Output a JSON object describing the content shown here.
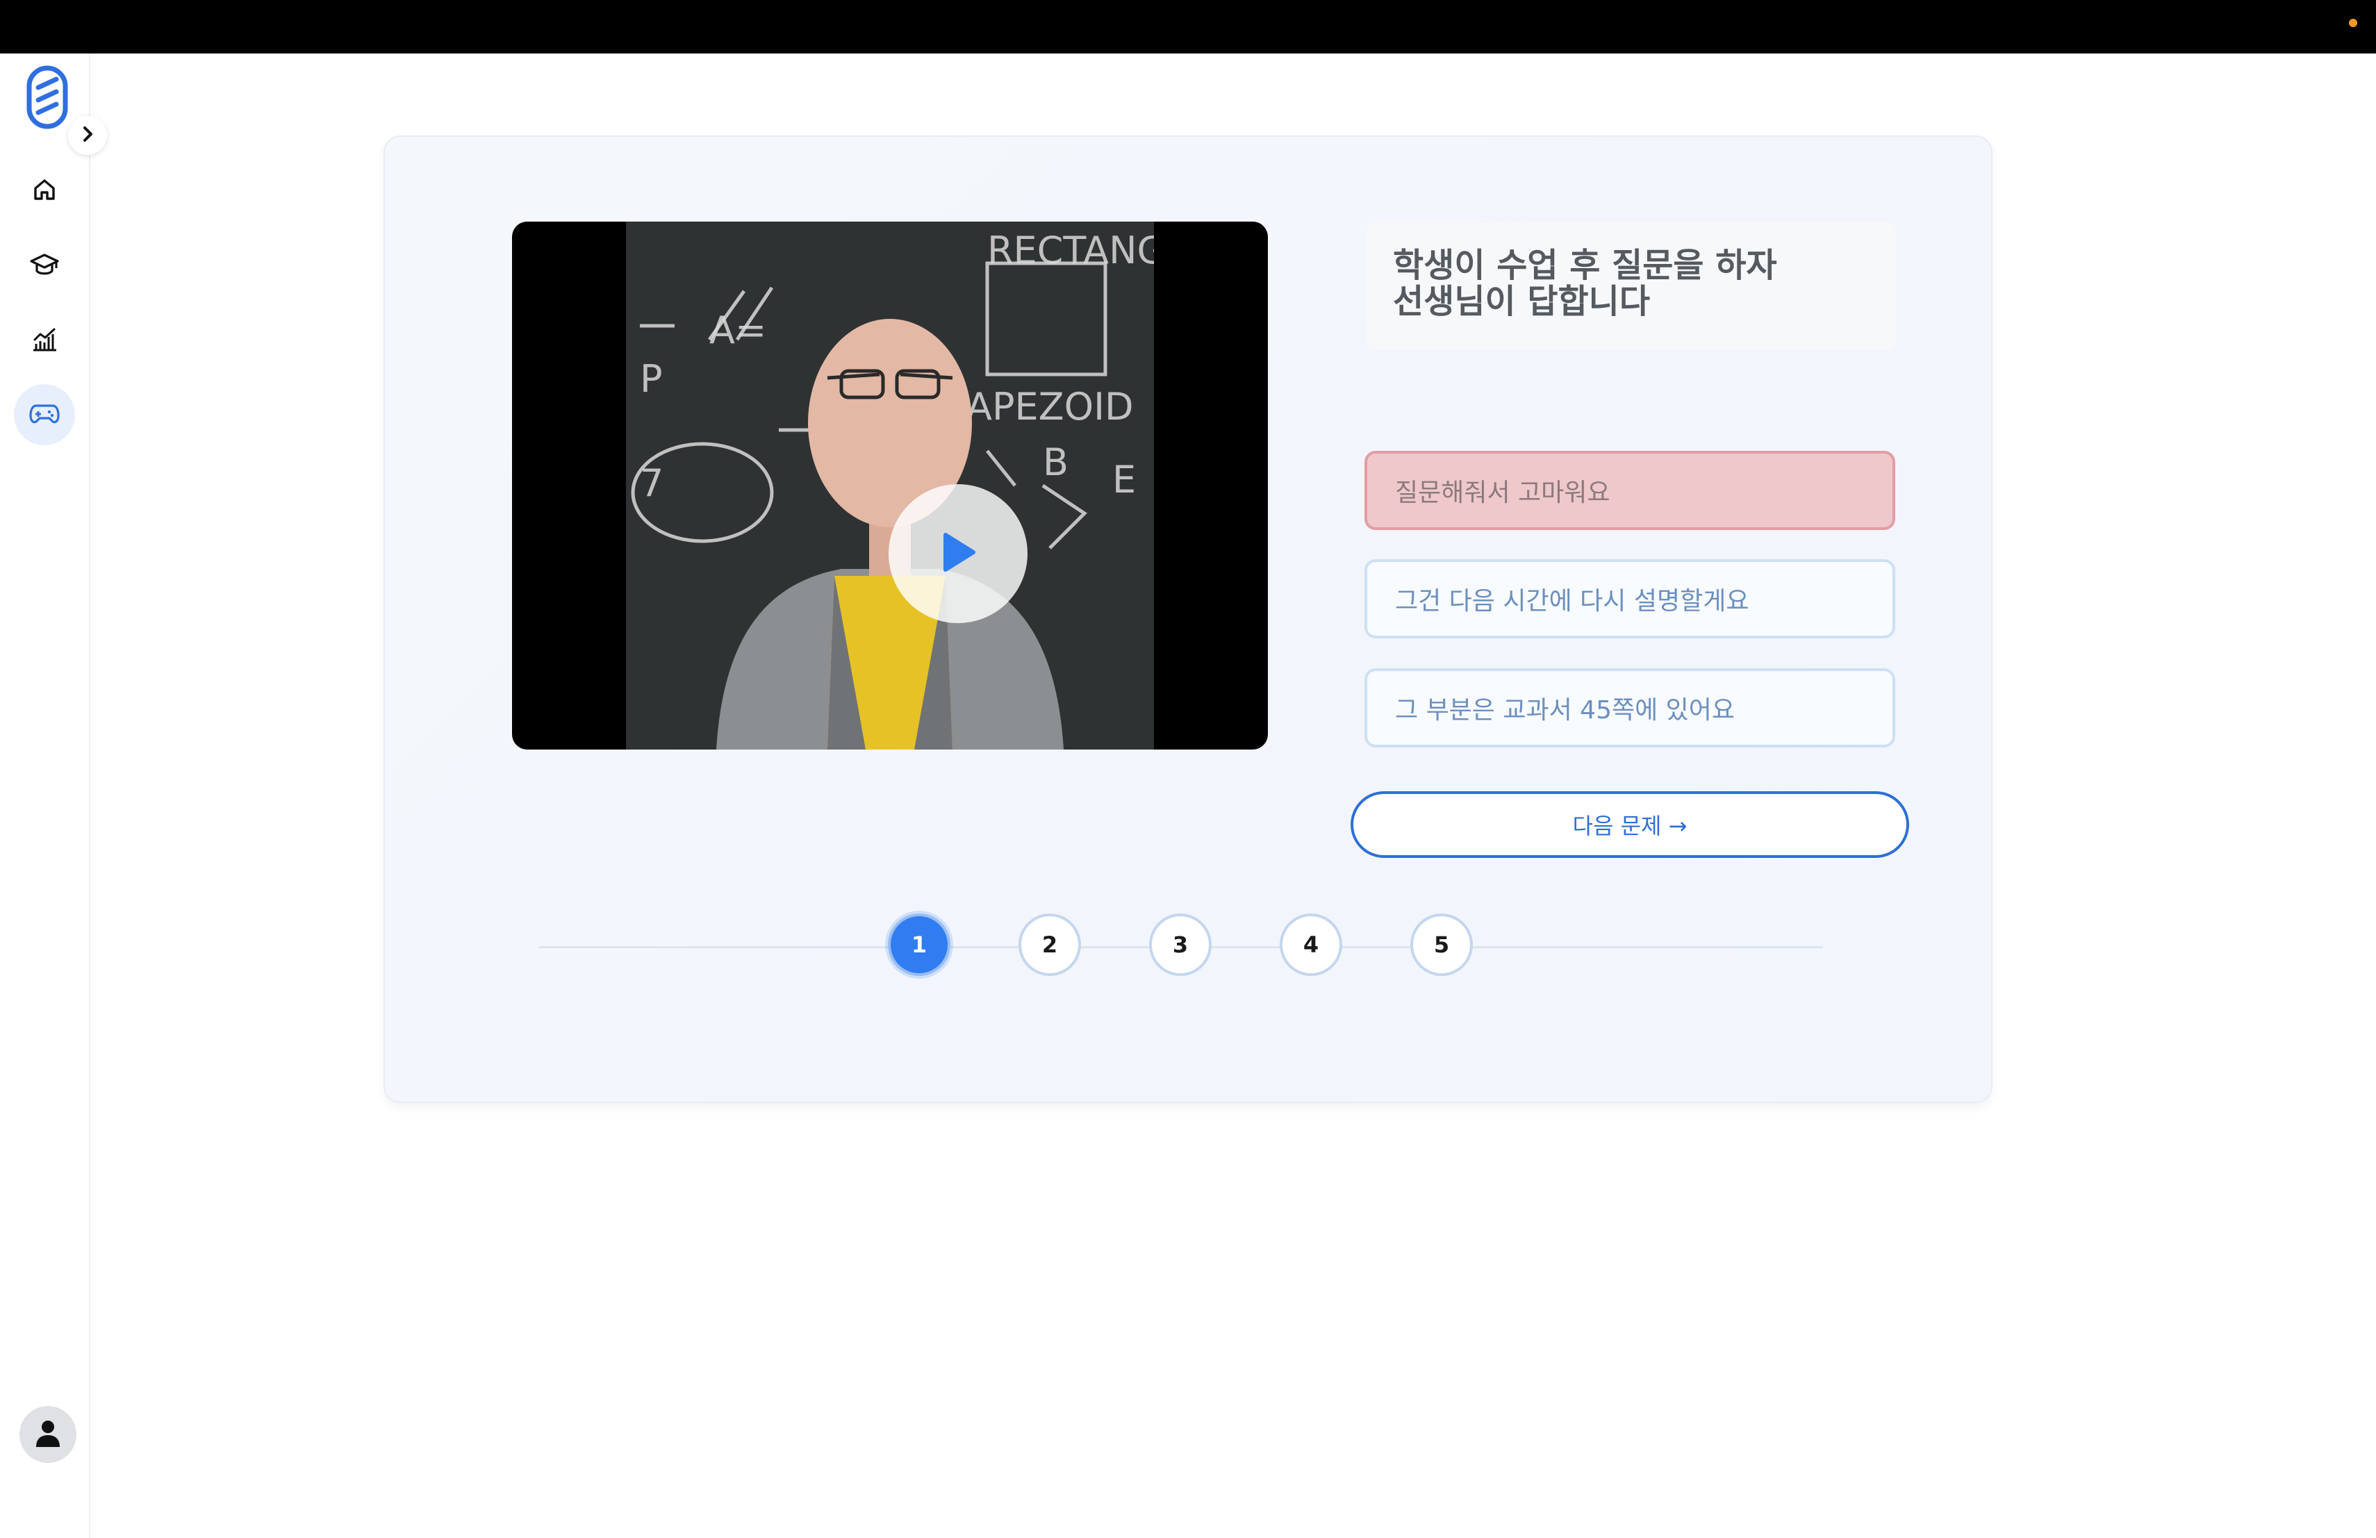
{
  "sidebar": {
    "logo_icon": "striped-capsule-logo-icon",
    "expand_icon": "chevron-right-icon",
    "items": [
      {
        "name": "home",
        "icon": "home-icon",
        "active": false
      },
      {
        "name": "courses",
        "icon": "graduation-cap-icon",
        "active": false
      },
      {
        "name": "analytics",
        "icon": "chart-icon",
        "active": false
      },
      {
        "name": "games",
        "icon": "gamepad-icon",
        "active": true
      }
    ],
    "user_icon": "user-icon"
  },
  "colors": {
    "accent": "#2f7df0",
    "selected_option_bg": "#efc8cb",
    "option_border": "#cfdff3"
  },
  "quiz": {
    "video_icon": "play-icon",
    "question_line1": "학생이 수업 후 질문을 하자",
    "question_line2": "선생님이 답합니다",
    "options": [
      {
        "label": "질문해줘서 고마워요",
        "selected": true
      },
      {
        "label": "그건 다음 시간에 다시 설명할게요",
        "selected": false
      },
      {
        "label": "그 부분은 교과서 45쪽에 있어요",
        "selected": false
      }
    ],
    "next_label": "다음 문제 →",
    "steps": [
      "1",
      "2",
      "3",
      "4",
      "5"
    ],
    "current_step": "1"
  }
}
